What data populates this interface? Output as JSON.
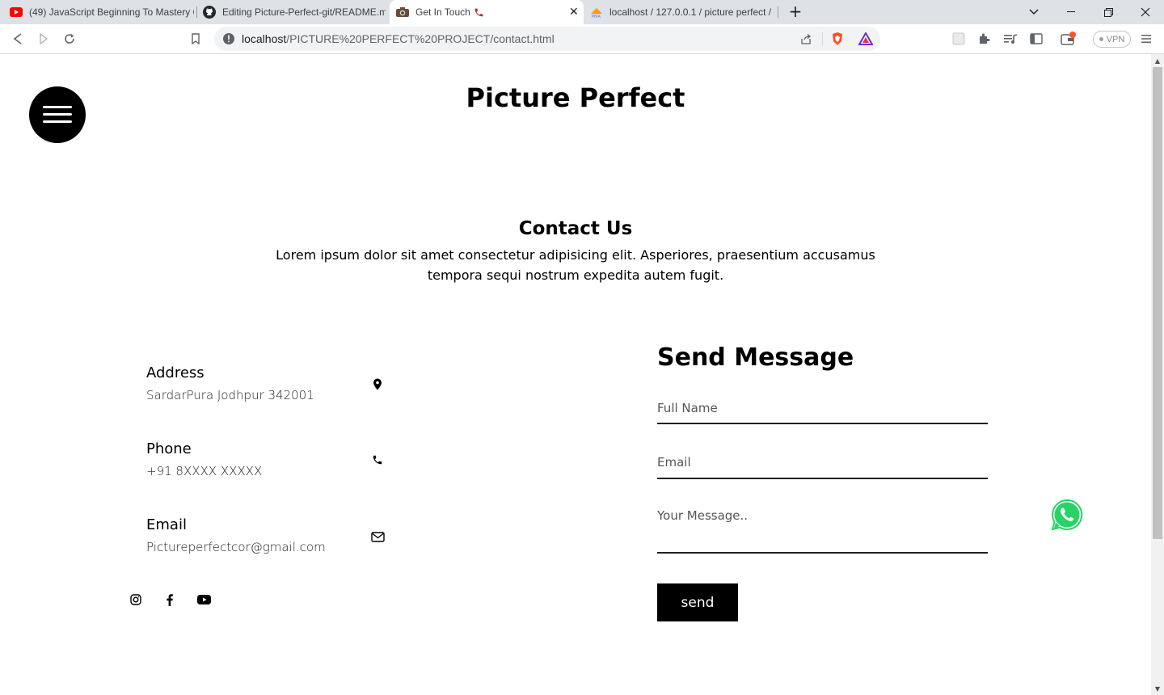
{
  "browser": {
    "tabs": [
      {
        "title": "(49) JavaScript Beginning To Mastery C",
        "icon": "youtube-icon"
      },
      {
        "title": "Editing Picture-Perfect-git/README.m",
        "icon": "github-icon"
      },
      {
        "title": "Get In Touch",
        "icon": "camera-icon",
        "active": true
      },
      {
        "title": "localhost / 127.0.0.1 / picture perfect /",
        "icon": "phpmyadmin-icon"
      }
    ],
    "url_host": "localhost",
    "url_path": "/PICTURE%20PERFECT%20PROJECT/contact.html",
    "vpn_label": "VPN"
  },
  "site": {
    "title": "Picture Perfect"
  },
  "contact": {
    "heading": "Contact Us",
    "description": "Lorem ipsum dolor sit amet consectetur adipisicing elit. Asperiores, praesentium accusamus tempora sequi nostrum expedita autem fugit.",
    "items": [
      {
        "label": "Address",
        "value": "SardarPura Jodhpur 342001",
        "icon": "map-pin-icon"
      },
      {
        "label": "Phone",
        "value": "+91 8XXXX XXXXX",
        "icon": "phone-icon"
      },
      {
        "label": "Email",
        "value": "Pictureperfectcor@gmail.com",
        "icon": "envelope-icon"
      }
    ],
    "social": [
      "instagram-icon",
      "facebook-icon",
      "youtube-icon"
    ]
  },
  "form": {
    "title": "Send Message",
    "name_placeholder": "Full Name",
    "email_placeholder": "Email",
    "message_placeholder": "Your Message..",
    "send_label": "send"
  },
  "colors": {
    "accent": "#000000",
    "whatsapp": "#25d366"
  }
}
